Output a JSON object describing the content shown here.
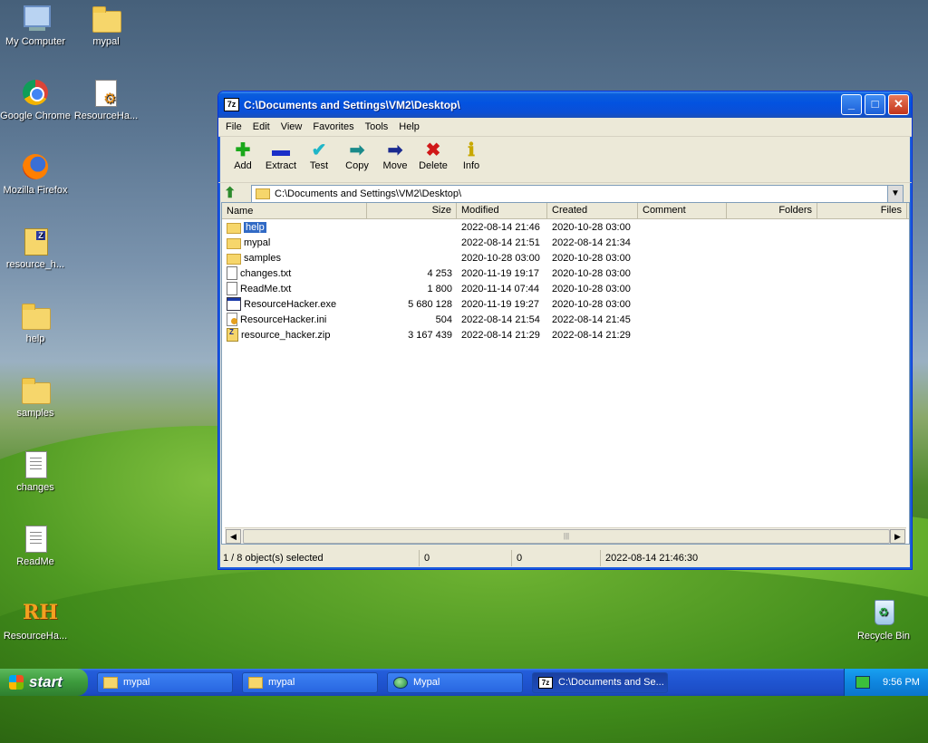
{
  "desktop": {
    "icons": [
      {
        "label": "My Computer"
      },
      {
        "label": "mypal"
      },
      {
        "label": "Google Chrome"
      },
      {
        "label": "ResourceHa..."
      },
      {
        "label": "Mozilla Firefox"
      },
      {
        "label": "resource_h..."
      },
      {
        "label": "help"
      },
      {
        "label": "samples"
      },
      {
        "label": "changes"
      },
      {
        "label": "ReadMe"
      },
      {
        "label": "ResourceHa..."
      },
      {
        "label": "Recycle Bin"
      }
    ]
  },
  "window": {
    "title": "C:\\Documents and Settings\\VM2\\Desktop\\",
    "app_icon": "7z",
    "menu": [
      "File",
      "Edit",
      "View",
      "Favorites",
      "Tools",
      "Help"
    ],
    "toolbar": [
      {
        "label": "Add",
        "icon": "plus-icon",
        "color": "#1aa81a",
        "glyph": "✚"
      },
      {
        "label": "Extract",
        "icon": "minus-icon",
        "color": "#1a2fc8",
        "glyph": "▬"
      },
      {
        "label": "Test",
        "icon": "check-icon",
        "color": "#1fb6c8",
        "glyph": "✔"
      },
      {
        "label": "Copy",
        "icon": "copy-arrow-icon",
        "color": "#1a8a8a",
        "glyph": "➡"
      },
      {
        "label": "Move",
        "icon": "move-arrow-icon",
        "color": "#1a2a90",
        "glyph": "➡"
      },
      {
        "label": "Delete",
        "icon": "delete-x-icon",
        "color": "#d01818",
        "glyph": "✖"
      },
      {
        "label": "Info",
        "icon": "info-icon",
        "color": "#c8a800",
        "glyph": "ℹ"
      }
    ],
    "address": "C:\\Documents and Settings\\VM2\\Desktop\\",
    "columns": {
      "name": "Name",
      "size": "Size",
      "modified": "Modified",
      "created": "Created",
      "comment": "Comment",
      "folders": "Folders",
      "files": "Files"
    },
    "rows": [
      {
        "name": "help",
        "size": "",
        "modified": "2022-08-14 21:46",
        "created": "2020-10-28 03:00",
        "type": "folder",
        "selected": true
      },
      {
        "name": "mypal",
        "size": "",
        "modified": "2022-08-14 21:51",
        "created": "2022-08-14 21:34",
        "type": "folder"
      },
      {
        "name": "samples",
        "size": "",
        "modified": "2020-10-28 03:00",
        "created": "2020-10-28 03:00",
        "type": "folder"
      },
      {
        "name": "changes.txt",
        "size": "4 253",
        "modified": "2020-11-19 19:17",
        "created": "2020-10-28 03:00",
        "type": "txt"
      },
      {
        "name": "ReadMe.txt",
        "size": "1 800",
        "modified": "2020-11-14 07:44",
        "created": "2020-10-28 03:00",
        "type": "txt"
      },
      {
        "name": "ResourceHacker.exe",
        "size": "5 680 128",
        "modified": "2020-11-19 19:27",
        "created": "2020-10-28 03:00",
        "type": "exe"
      },
      {
        "name": "ResourceHacker.ini",
        "size": "504",
        "modified": "2022-08-14 21:54",
        "created": "2022-08-14 21:45",
        "type": "ini"
      },
      {
        "name": "resource_hacker.zip",
        "size": "3 167 439",
        "modified": "2022-08-14 21:29",
        "created": "2022-08-14 21:29",
        "type": "zip"
      }
    ],
    "status": {
      "selection": "1 / 8 object(s) selected",
      "size1": "0",
      "size2": "0",
      "date": "2022-08-14 21:46:30"
    }
  },
  "taskbar": {
    "start_label": "start",
    "items": [
      {
        "label": "mypal",
        "icon": "folder-icon"
      },
      {
        "label": "mypal",
        "icon": "folder-icon"
      },
      {
        "label": "Mypal",
        "icon": "globe-icon"
      },
      {
        "label": "C:\\Documents and Se...",
        "icon": "7z-icon",
        "active": true
      }
    ],
    "clock": "9:56 PM"
  }
}
